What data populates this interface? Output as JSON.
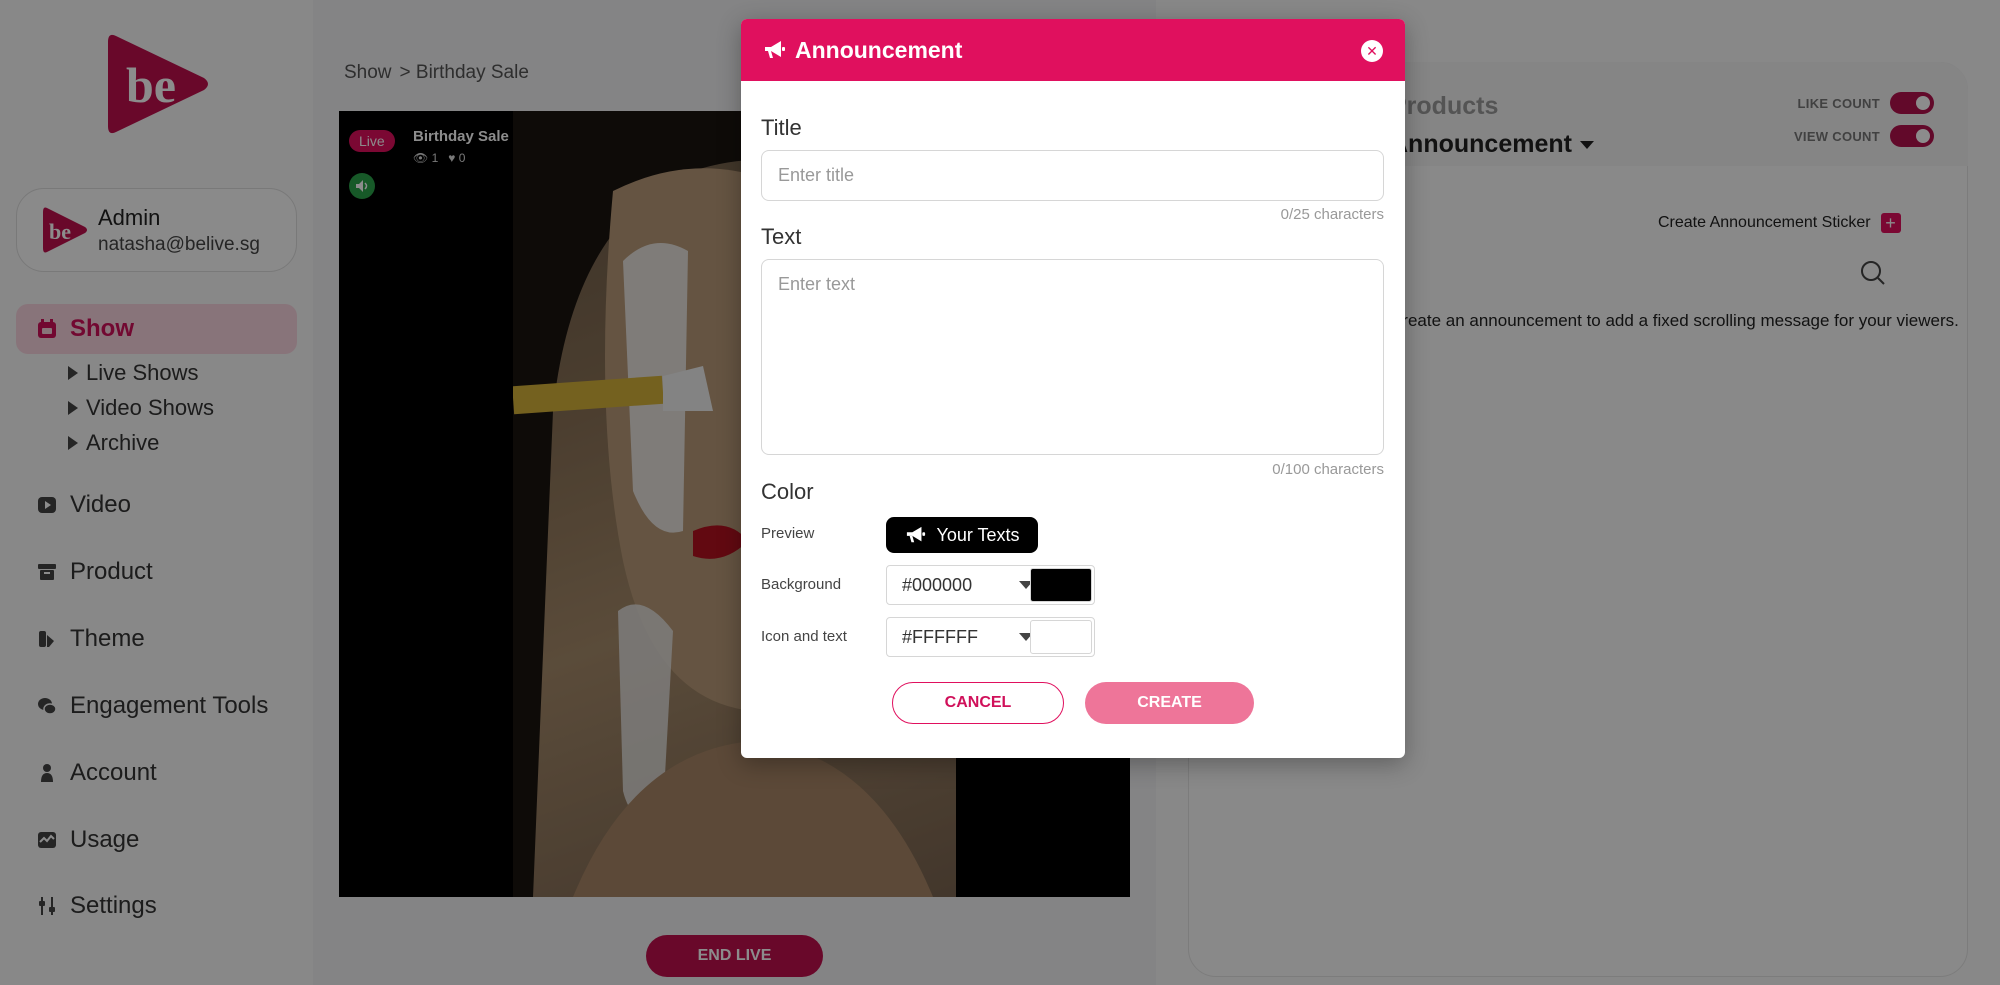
{
  "app": {
    "brand_color": "#e0105e"
  },
  "sidebar": {
    "logo_text": "be",
    "admin": {
      "name": "Admin",
      "email": "natasha@belive.sg"
    },
    "nav": [
      {
        "label": "Show",
        "icon": "calendar-icon",
        "active": true
      },
      {
        "label": "Video",
        "icon": "play-icon"
      },
      {
        "label": "Product",
        "icon": "box-icon"
      },
      {
        "label": "Theme",
        "icon": "palette-icon"
      },
      {
        "label": "Engagement Tools",
        "icon": "chat-bubbles-icon"
      },
      {
        "label": "Account",
        "icon": "user-icon"
      },
      {
        "label": "Usage",
        "icon": "chart-icon"
      },
      {
        "label": "Settings",
        "icon": "sliders-icon"
      }
    ],
    "sub_nav": [
      "Live Shows",
      "Video Shows",
      "Archive"
    ]
  },
  "breadcrumb": {
    "root": "Show",
    "current": "> Birthday Sale"
  },
  "player": {
    "live_badge": "Live",
    "title": "Birthday Sale",
    "views": "1",
    "likes": "0",
    "end_live_label": "END LIVE"
  },
  "right_panel": {
    "tab_products": "Products",
    "tab_current": "Announcement",
    "like_count_label": "LIKE COUNT",
    "view_count_label": "VIEW COUNT",
    "like_count_enabled": true,
    "view_count_enabled": true,
    "create_sticker_label": "Create Announcement Sticker",
    "hint_text": "Create an announcement to add a fixed scrolling message for your viewers."
  },
  "modal": {
    "title": "Announcement",
    "title_label": "Title",
    "title_placeholder": "Enter title",
    "title_counter": "0/25 characters",
    "text_label": "Text",
    "text_placeholder": "Enter text",
    "text_counter": "0/100 characters",
    "color_label": "Color",
    "preview_label": "Preview",
    "preview_text": "Your Texts",
    "background_label": "Background",
    "background_value": "#000000",
    "icon_text_label": "Icon and text",
    "icon_text_value": "#FFFFFF",
    "cancel_label": "CANCEL",
    "create_label": "CREATE"
  }
}
